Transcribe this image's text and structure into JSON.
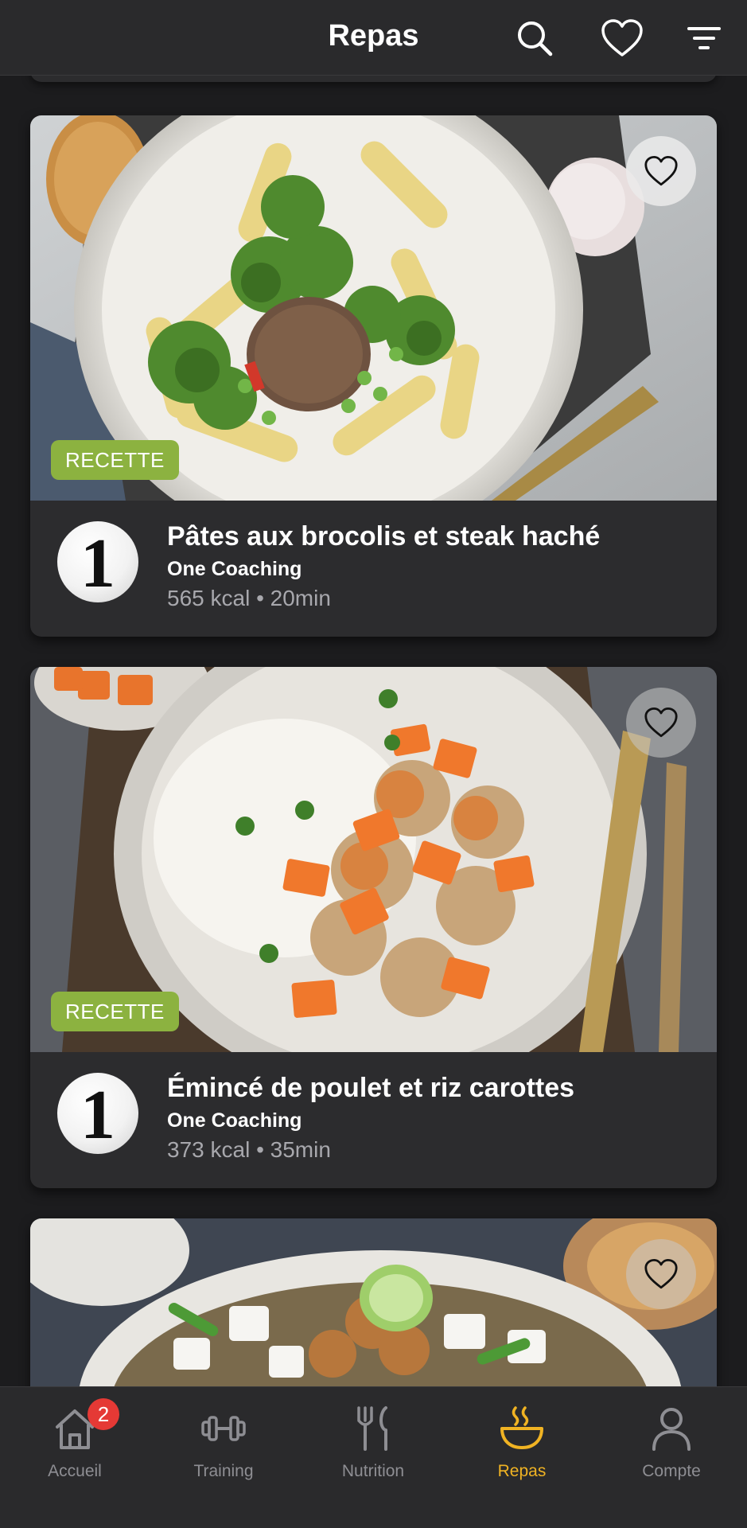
{
  "header": {
    "title": "Repas",
    "icons": [
      "search-icon",
      "heart-icon",
      "filter-icon"
    ]
  },
  "recipes": [
    {
      "tag": "RECETTE",
      "title": "Pâtes aux brocolis et steak haché",
      "author": "One Coaching",
      "meta": "565 kcal • 20min",
      "logo": "1"
    },
    {
      "tag": "RECETTE",
      "title": "Émincé de poulet et riz carottes",
      "author": "One Coaching",
      "meta": "373 kcal • 35min",
      "logo": "1"
    }
  ],
  "tabbar": {
    "items": [
      {
        "label": "Accueil",
        "icon": "home-icon",
        "badge": "2"
      },
      {
        "label": "Training",
        "icon": "dumbbell-icon"
      },
      {
        "label": "Nutrition",
        "icon": "fork-knife-icon"
      },
      {
        "label": "Repas",
        "icon": "bowl-icon",
        "active": true
      },
      {
        "label": "Compte",
        "icon": "user-icon"
      }
    ]
  },
  "colors": {
    "accent": "#f0b323",
    "tag_green": "#8cb240",
    "badge_red": "#e53935",
    "background": "#1c1c1e",
    "card": "#2c2c2e"
  }
}
